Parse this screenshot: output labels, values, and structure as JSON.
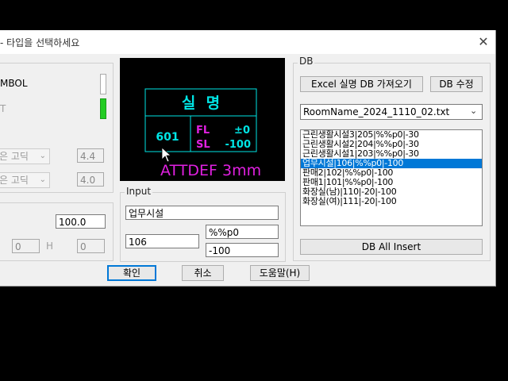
{
  "dialog": {
    "title": "- 타입을 선택하세요",
    "close_glyph": "✕"
  },
  "left_panel": {
    "symbol_label": "MBOL",
    "t_label": "T",
    "font1": "은 고딕",
    "font1_value": "4.4",
    "font2": "은 고딕",
    "font2_value": "4.0",
    "scale_value": "100.0",
    "w_value": "0",
    "h_label": "H",
    "h_value": "0"
  },
  "preview": {
    "room_name": "실  명",
    "number": "601",
    "fl_label": "FL",
    "fl_value": "±0",
    "sl_label": "SL",
    "sl_value": "-100",
    "attdef_text": "ATTDEF 3mm"
  },
  "input": {
    "group_label": "Input",
    "name_value": "업무시설",
    "number_value": "106",
    "fl_value": "%%p0",
    "sl_value": "-100"
  },
  "db": {
    "group_label": "DB",
    "excel_button": "Excel 실명 DB 가져오기",
    "edit_button": "DB 수정",
    "file_selected": "RoomName_2024_1110_02.txt",
    "items": [
      "근린생활시설3|205|%%p0|-30",
      "근린생활시설2|204|%%p0|-30",
      "근린생활시설1|203|%%p0|-30",
      "업무시설|106|%%p0|-100",
      "판매2|102|%%p0|-100",
      "판매1|101|%%p0|-100",
      "화장실(남)|110|-20|-100",
      "화장실(여)|111|-20|-100"
    ],
    "selected_index": 3,
    "insert_all_button": "DB All Insert"
  },
  "footer": {
    "ok_button": "확인",
    "cancel_button": "취소",
    "help_button": "도움말(H)"
  },
  "colors": {
    "selection": "#0078d7",
    "preview_cyan": "#00e5e5",
    "preview_magenta": "#e020e0"
  }
}
